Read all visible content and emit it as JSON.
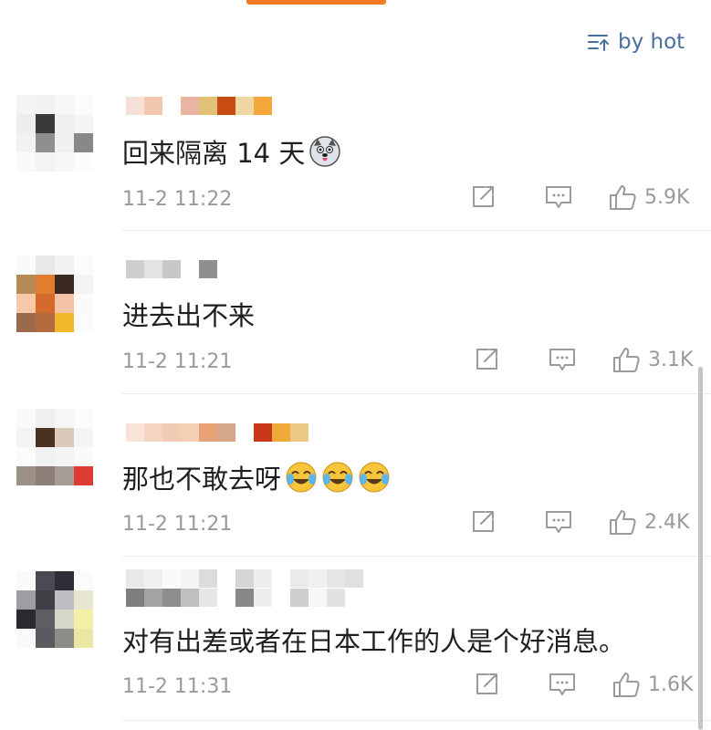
{
  "sort": {
    "label": "by hot",
    "icon": "sort-icon"
  },
  "comments": [
    {
      "text": "回来隔离 14 天",
      "emoji": [
        "husky-dog-emoji"
      ],
      "time": "11-2 11:22",
      "likes": "5.9K"
    },
    {
      "text": "进去出不来",
      "emoji": [],
      "time": "11-2 11:21",
      "likes": "3.1K"
    },
    {
      "text": "那也不敢去呀",
      "emoji": [
        "laugh-cry-emoji",
        "laugh-cry-emoji",
        "laugh-cry-emoji"
      ],
      "time": "11-2 11:21",
      "likes": "2.4K"
    },
    {
      "text": "对有出差或者在日本工作的人是个好消息。",
      "emoji": [],
      "time": "11-2 11:31",
      "likes": "1.6K"
    }
  ],
  "colors": {
    "accent": "#f57b22",
    "link": "#4a6f9e",
    "meta": "#9a9a9a"
  },
  "icons": {
    "share": "share-icon",
    "reply": "comment-icon",
    "like": "thumbs-up-icon"
  }
}
